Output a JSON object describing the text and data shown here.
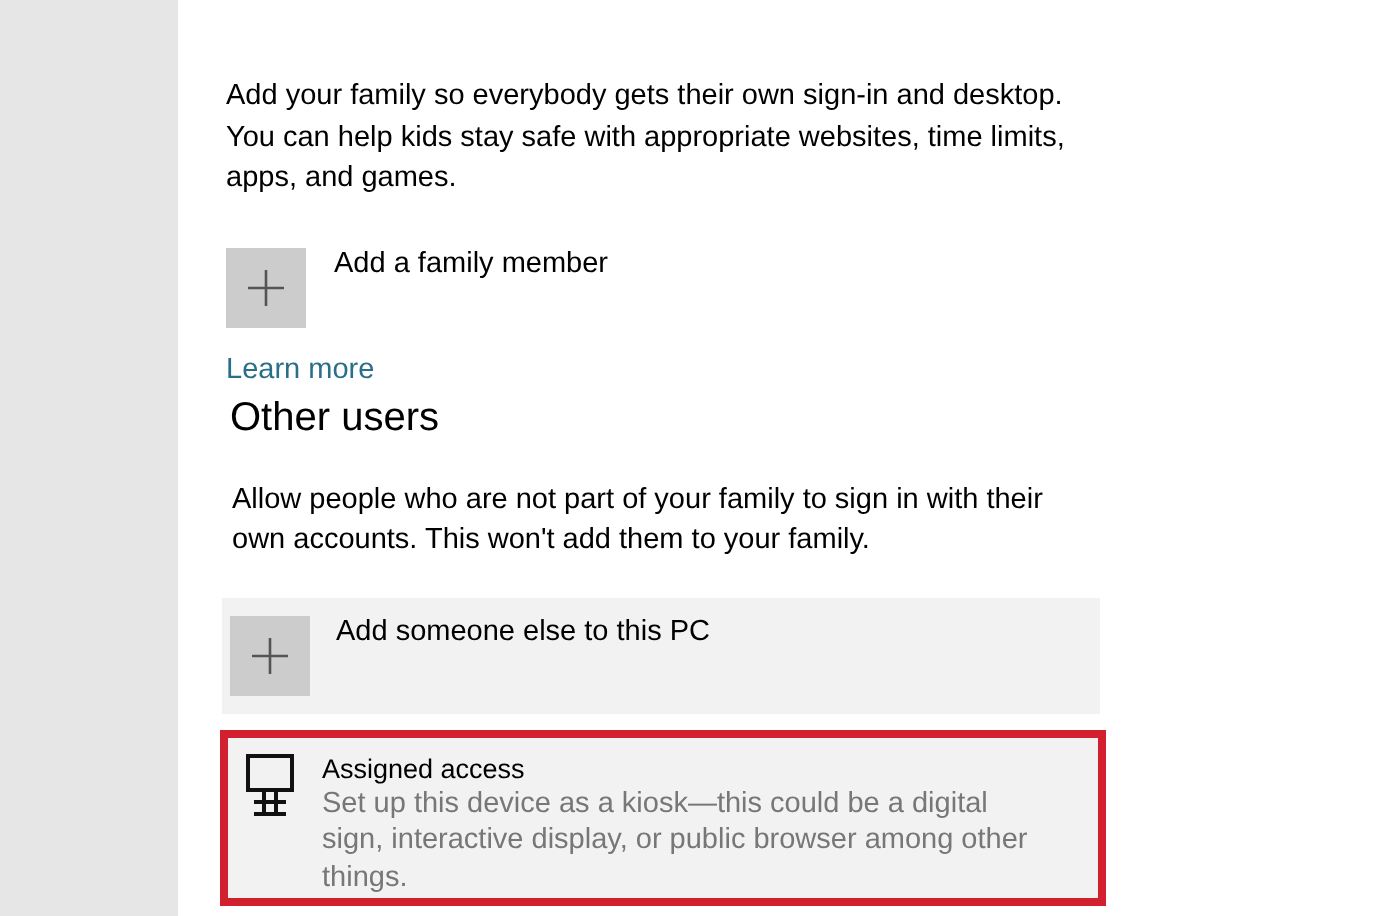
{
  "family": {
    "description": "Add your family so everybody gets their own sign-in and desktop. You can help kids stay safe with appropriate websites, time limits, apps, and games.",
    "add_button": {
      "label": "Add a family member"
    },
    "link": "Learn more"
  },
  "other_users": {
    "heading": "Other users",
    "description": "Allow people who are not part of your family to sign in with their own accounts. This won't add them to your family.",
    "items": [
      {
        "kind": "add",
        "label": "Add someone else to this PC",
        "highlighted": false
      },
      {
        "kind": "kiosk",
        "label": "Assigned access",
        "description": "Set up this device as a kiosk—this could be a digital sign, interactive display, or public browser among other things.",
        "highlighted": true
      }
    ]
  }
}
